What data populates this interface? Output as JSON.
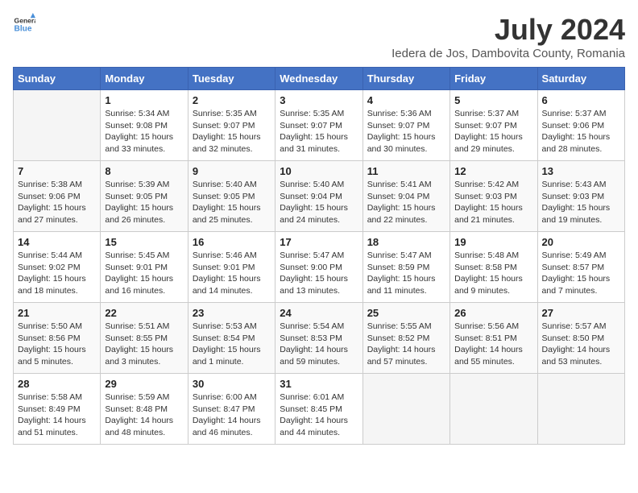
{
  "header": {
    "logo_line1": "General",
    "logo_line2": "Blue",
    "title": "July 2024",
    "subtitle": "Iedera de Jos, Dambovita County, Romania"
  },
  "days_of_week": [
    "Sunday",
    "Monday",
    "Tuesday",
    "Wednesday",
    "Thursday",
    "Friday",
    "Saturday"
  ],
  "weeks": [
    [
      {
        "day": "",
        "info": ""
      },
      {
        "day": "1",
        "info": "Sunrise: 5:34 AM\nSunset: 9:08 PM\nDaylight: 15 hours\nand 33 minutes."
      },
      {
        "day": "2",
        "info": "Sunrise: 5:35 AM\nSunset: 9:07 PM\nDaylight: 15 hours\nand 32 minutes."
      },
      {
        "day": "3",
        "info": "Sunrise: 5:35 AM\nSunset: 9:07 PM\nDaylight: 15 hours\nand 31 minutes."
      },
      {
        "day": "4",
        "info": "Sunrise: 5:36 AM\nSunset: 9:07 PM\nDaylight: 15 hours\nand 30 minutes."
      },
      {
        "day": "5",
        "info": "Sunrise: 5:37 AM\nSunset: 9:07 PM\nDaylight: 15 hours\nand 29 minutes."
      },
      {
        "day": "6",
        "info": "Sunrise: 5:37 AM\nSunset: 9:06 PM\nDaylight: 15 hours\nand 28 minutes."
      }
    ],
    [
      {
        "day": "7",
        "info": "Sunrise: 5:38 AM\nSunset: 9:06 PM\nDaylight: 15 hours\nand 27 minutes."
      },
      {
        "day": "8",
        "info": "Sunrise: 5:39 AM\nSunset: 9:05 PM\nDaylight: 15 hours\nand 26 minutes."
      },
      {
        "day": "9",
        "info": "Sunrise: 5:40 AM\nSunset: 9:05 PM\nDaylight: 15 hours\nand 25 minutes."
      },
      {
        "day": "10",
        "info": "Sunrise: 5:40 AM\nSunset: 9:04 PM\nDaylight: 15 hours\nand 24 minutes."
      },
      {
        "day": "11",
        "info": "Sunrise: 5:41 AM\nSunset: 9:04 PM\nDaylight: 15 hours\nand 22 minutes."
      },
      {
        "day": "12",
        "info": "Sunrise: 5:42 AM\nSunset: 9:03 PM\nDaylight: 15 hours\nand 21 minutes."
      },
      {
        "day": "13",
        "info": "Sunrise: 5:43 AM\nSunset: 9:03 PM\nDaylight: 15 hours\nand 19 minutes."
      }
    ],
    [
      {
        "day": "14",
        "info": "Sunrise: 5:44 AM\nSunset: 9:02 PM\nDaylight: 15 hours\nand 18 minutes."
      },
      {
        "day": "15",
        "info": "Sunrise: 5:45 AM\nSunset: 9:01 PM\nDaylight: 15 hours\nand 16 minutes."
      },
      {
        "day": "16",
        "info": "Sunrise: 5:46 AM\nSunset: 9:01 PM\nDaylight: 15 hours\nand 14 minutes."
      },
      {
        "day": "17",
        "info": "Sunrise: 5:47 AM\nSunset: 9:00 PM\nDaylight: 15 hours\nand 13 minutes."
      },
      {
        "day": "18",
        "info": "Sunrise: 5:47 AM\nSunset: 8:59 PM\nDaylight: 15 hours\nand 11 minutes."
      },
      {
        "day": "19",
        "info": "Sunrise: 5:48 AM\nSunset: 8:58 PM\nDaylight: 15 hours\nand 9 minutes."
      },
      {
        "day": "20",
        "info": "Sunrise: 5:49 AM\nSunset: 8:57 PM\nDaylight: 15 hours\nand 7 minutes."
      }
    ],
    [
      {
        "day": "21",
        "info": "Sunrise: 5:50 AM\nSunset: 8:56 PM\nDaylight: 15 hours\nand 5 minutes."
      },
      {
        "day": "22",
        "info": "Sunrise: 5:51 AM\nSunset: 8:55 PM\nDaylight: 15 hours\nand 3 minutes."
      },
      {
        "day": "23",
        "info": "Sunrise: 5:53 AM\nSunset: 8:54 PM\nDaylight: 15 hours\nand 1 minute."
      },
      {
        "day": "24",
        "info": "Sunrise: 5:54 AM\nSunset: 8:53 PM\nDaylight: 14 hours\nand 59 minutes."
      },
      {
        "day": "25",
        "info": "Sunrise: 5:55 AM\nSunset: 8:52 PM\nDaylight: 14 hours\nand 57 minutes."
      },
      {
        "day": "26",
        "info": "Sunrise: 5:56 AM\nSunset: 8:51 PM\nDaylight: 14 hours\nand 55 minutes."
      },
      {
        "day": "27",
        "info": "Sunrise: 5:57 AM\nSunset: 8:50 PM\nDaylight: 14 hours\nand 53 minutes."
      }
    ],
    [
      {
        "day": "28",
        "info": "Sunrise: 5:58 AM\nSunset: 8:49 PM\nDaylight: 14 hours\nand 51 minutes."
      },
      {
        "day": "29",
        "info": "Sunrise: 5:59 AM\nSunset: 8:48 PM\nDaylight: 14 hours\nand 48 minutes."
      },
      {
        "day": "30",
        "info": "Sunrise: 6:00 AM\nSunset: 8:47 PM\nDaylight: 14 hours\nand 46 minutes."
      },
      {
        "day": "31",
        "info": "Sunrise: 6:01 AM\nSunset: 8:45 PM\nDaylight: 14 hours\nand 44 minutes."
      },
      {
        "day": "",
        "info": ""
      },
      {
        "day": "",
        "info": ""
      },
      {
        "day": "",
        "info": ""
      }
    ]
  ]
}
